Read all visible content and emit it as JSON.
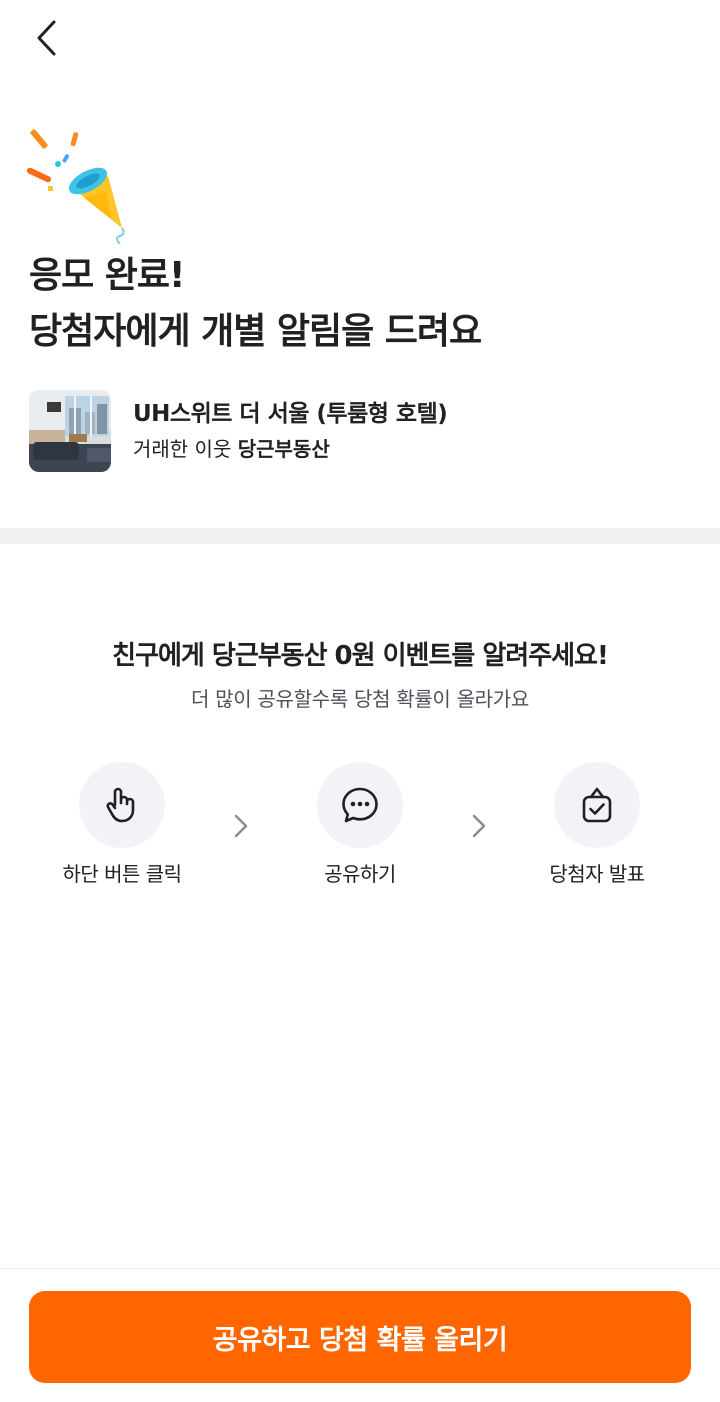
{
  "header": {
    "back_icon": "chevron-left-icon"
  },
  "hero": {
    "icon": "party-popper-icon",
    "headline_line1": "응모 완료!",
    "headline_line2": "당첨자에게 개별 알림을 드려요"
  },
  "item": {
    "title": "UH스위트 더 서울 (투룸형 호텔)",
    "sub_prefix": "거래한 이웃 ",
    "sub_name": "당근부동산"
  },
  "promo": {
    "title": "친구에게 당근부동산 0원 이벤트를 알려주세요!",
    "subtitle": "더 많이 공유할수록 당첨 확률이 올라가요"
  },
  "steps": [
    {
      "icon": "hand-pointer-icon",
      "label": "하단 버튼 클릭"
    },
    {
      "icon": "chat-bubble-icon",
      "label": "공유하기"
    },
    {
      "icon": "gift-box-check-icon",
      "label": "당첨자 발표"
    }
  ],
  "cta": {
    "label": "공유하고 당첨 확률 올리기",
    "color": "#ff6600"
  }
}
